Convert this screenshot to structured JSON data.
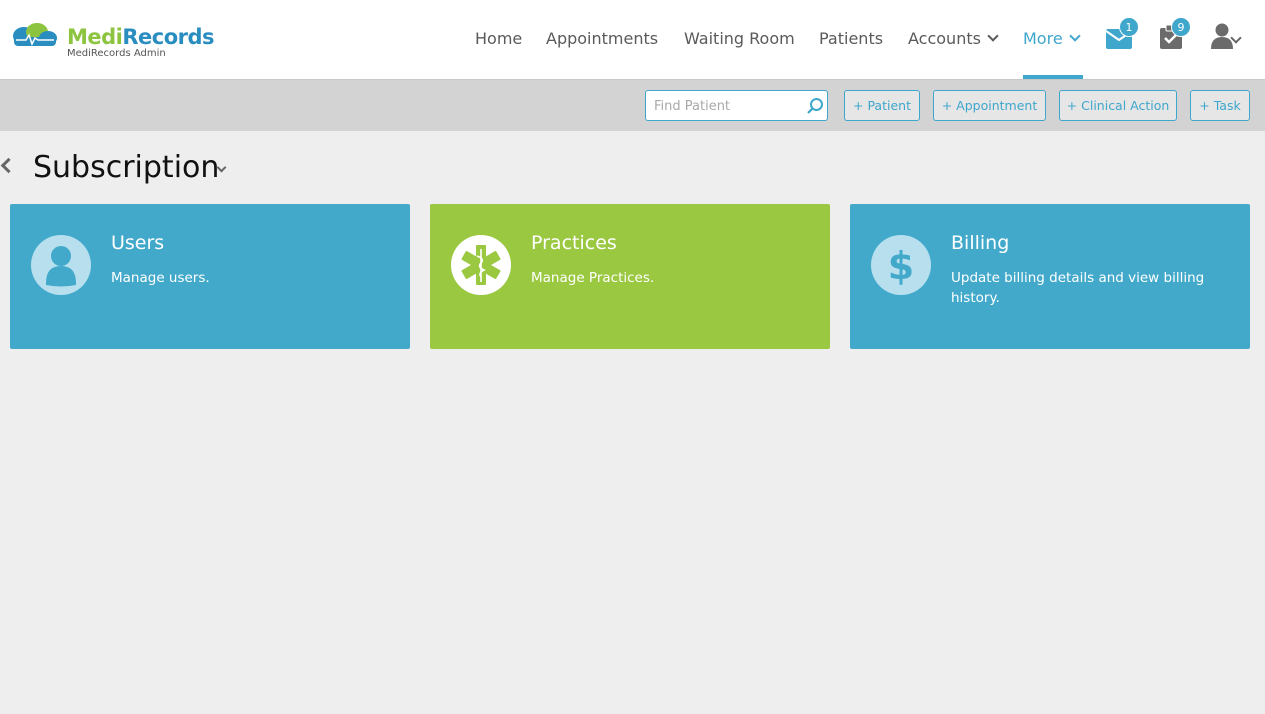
{
  "app": {
    "logo_part1": "Medi",
    "logo_part2": "Records",
    "logo_subtitle": "MediRecords Admin"
  },
  "nav": {
    "items": [
      {
        "label": "Home"
      },
      {
        "label": "Appointments"
      },
      {
        "label": "Waiting Room"
      },
      {
        "label": "Patients"
      },
      {
        "label": "Accounts"
      },
      {
        "label": "More"
      }
    ],
    "active": "More",
    "messages_badge": "1",
    "tasks_badge": "9",
    "icons": [
      "envelope-icon",
      "tasks-icon",
      "user-icon",
      "chevron-down-icon"
    ]
  },
  "toolbar": {
    "search_placeholder": "Find Patient",
    "search_value": "",
    "buttons": [
      {
        "label": "+ Patient"
      },
      {
        "label": "+ Appointment"
      },
      {
        "label": "+ Clinical Action"
      },
      {
        "label": "+ Task"
      }
    ]
  },
  "page": {
    "title": "Subscription"
  },
  "tiles": [
    {
      "title": "Users",
      "description": "Manage users.",
      "icon": "user-icon",
      "color": "#42a9cb"
    },
    {
      "title": "Practices",
      "description": "Manage Practices.",
      "icon": "medical-star-icon",
      "color": "#9ac841"
    },
    {
      "title": "Billing",
      "description": "Update billing details and view billing history.",
      "icon": "dollar-icon",
      "color": "#42a9cb"
    }
  ],
  "colors": {
    "accent": "#3fa6cc",
    "brand_green": "#8cc43f",
    "brand_blue": "#2a8dbf",
    "toolbar_bg": "#d3d3d3",
    "page_bg": "#eeeeee"
  }
}
